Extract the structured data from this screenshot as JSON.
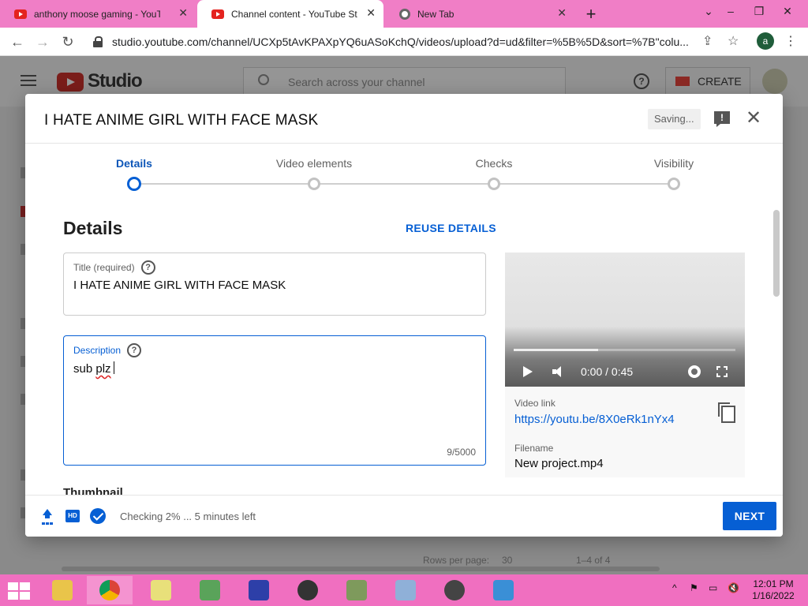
{
  "browser": {
    "tabs": [
      {
        "title": "anthony moose gaming - YouTub",
        "icon": "youtube-icon",
        "active": false
      },
      {
        "title": "Channel content - YouTube Studi",
        "icon": "youtube-icon",
        "active": true
      },
      {
        "title": "New Tab",
        "icon": "chrome-icon",
        "active": false
      }
    ],
    "url": "studio.youtube.com/channel/UCXp5tAvKPAXpYQ6uASoKchQ/videos/upload?d=ud&filter=%5B%5D&sort=%7B\"colu...",
    "profile_initial": "a"
  },
  "studio": {
    "logo_text": "Studio",
    "search_placeholder": "Search across your channel",
    "create_label": "CREATE",
    "help_glyph": "?",
    "footer": {
      "rows_per_page": "Rows per page:",
      "rows_value": "30",
      "range": "1–4 of 4"
    }
  },
  "dialog": {
    "title": "I HATE ANIME GIRL WITH FACE MASK",
    "saving_label": "Saving...",
    "steps": [
      {
        "label": "Details",
        "active": true
      },
      {
        "label": "Video elements",
        "active": false
      },
      {
        "label": "Checks",
        "active": false
      },
      {
        "label": "Visibility",
        "active": false
      }
    ],
    "section_title": "Details",
    "reuse_label": "REUSE DETAILS",
    "title_field": {
      "label": "Title (required)",
      "value": "I HATE ANIME GIRL WITH FACE MASK"
    },
    "description_field": {
      "label": "Description",
      "value_word1": "sub",
      "value_word2": "plz",
      "counter": "9/5000"
    },
    "thumbnail_label": "Thumbnail",
    "preview": {
      "time": "0:00 / 0:45",
      "progress_fraction": 0.38,
      "video_link_label": "Video link",
      "video_link": "https://youtu.be/8X0eRk1nYx4",
      "filename_label": "Filename",
      "filename": "New project.mp4"
    },
    "footer": {
      "hd_badge": "HD",
      "status": "Checking 2% ... 5 minutes left",
      "next_label": "NEXT"
    }
  },
  "taskbar": {
    "clock_time": "12:01 PM",
    "clock_date": "1/16/2022"
  },
  "colors": {
    "accent": "#065fd4",
    "tab_bar": "#f07ec6",
    "taskbar": "#f06fc0"
  }
}
